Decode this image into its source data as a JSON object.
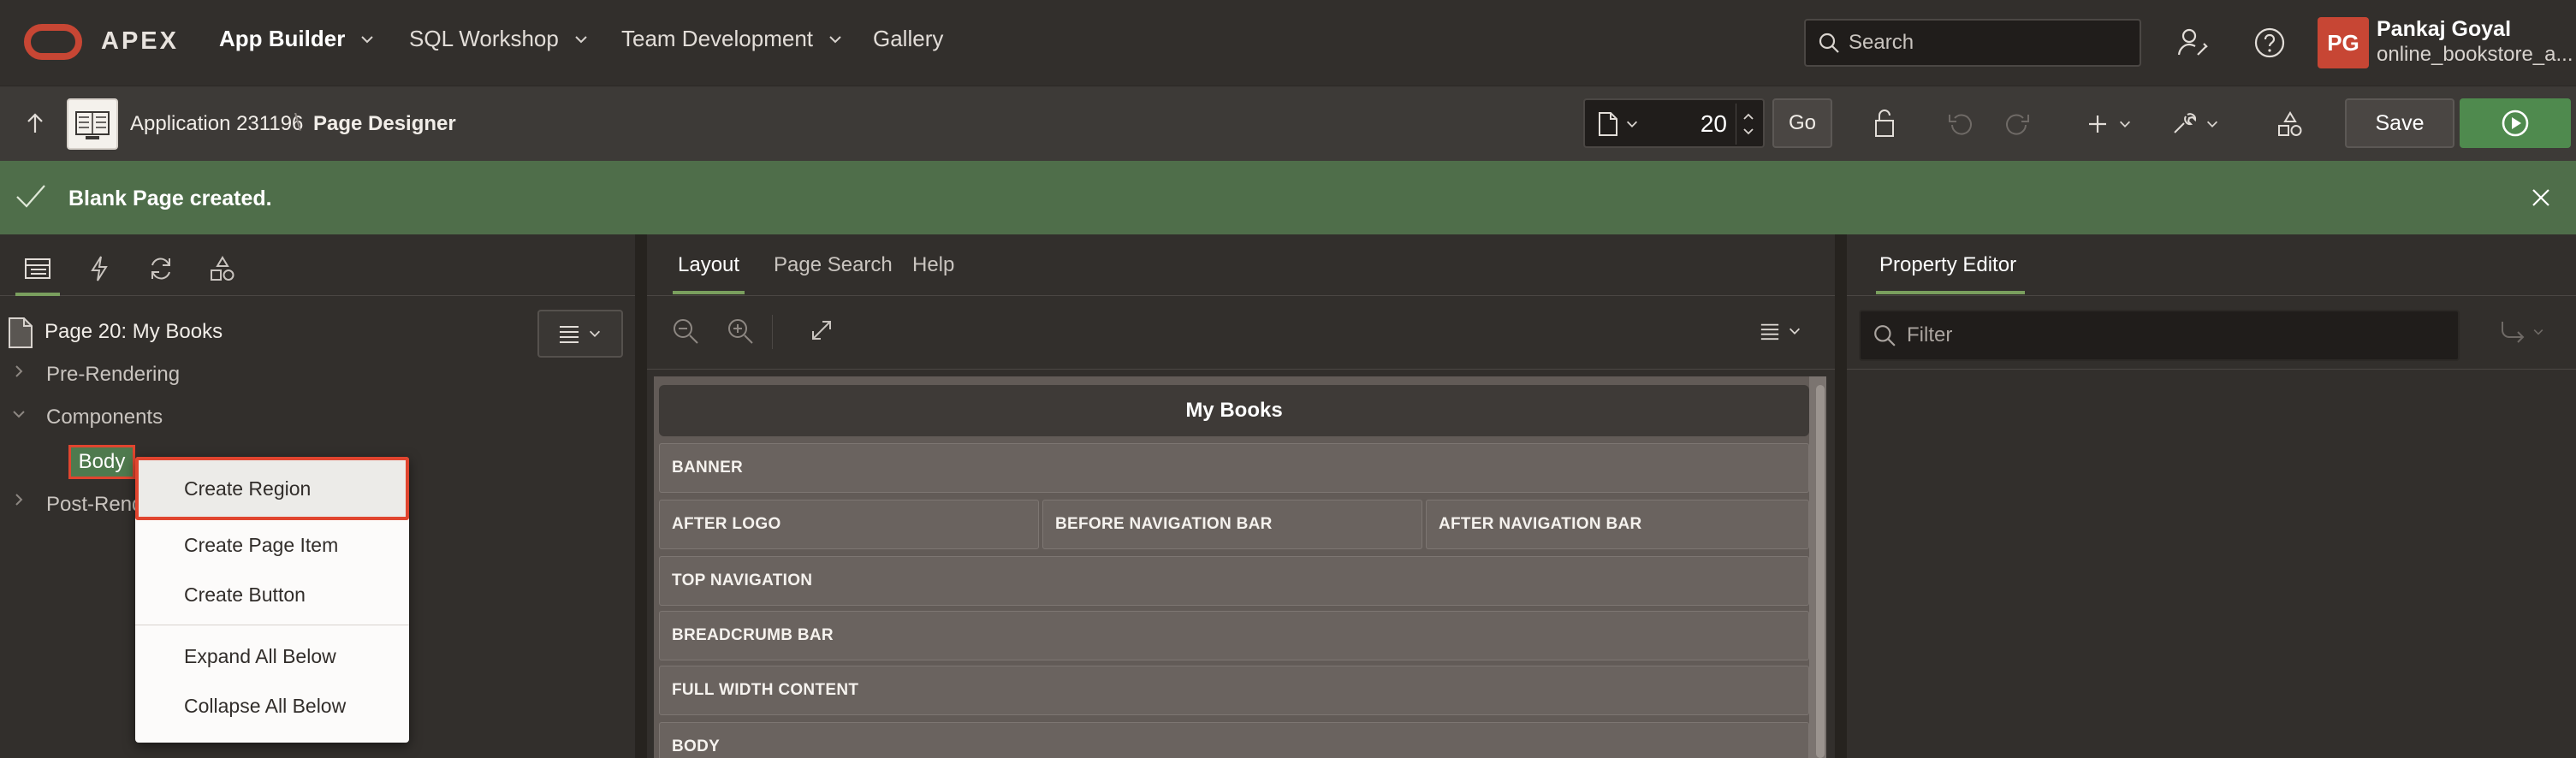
{
  "app": {
    "brand": "APEX",
    "nav": [
      "App Builder",
      "SQL Workshop",
      "Team Development",
      "Gallery"
    ],
    "search_placeholder": "Search",
    "user": {
      "initials": "PG",
      "name": "Pankaj Goyal",
      "workspace": "online_bookstore_a..."
    }
  },
  "toolbar": {
    "breadcrumb": [
      "Application 231196",
      "Page Designer"
    ],
    "breadcrumb_separator": "\\",
    "page_number": "20",
    "go_label": "Go",
    "save_label": "Save"
  },
  "banner": {
    "message": "Blank Page created."
  },
  "tree": {
    "root": "Page 20: My Books",
    "nodes": [
      "Pre-Rendering",
      "Components",
      "Post-Rend"
    ],
    "body": "Body"
  },
  "context_menu": {
    "items": [
      "Create Region",
      "Create Page Item",
      "Create Button",
      "Expand All Below",
      "Collapse All Below"
    ]
  },
  "center": {
    "tabs": [
      "Layout",
      "Page Search",
      "Help"
    ],
    "page_title": "My Books",
    "slots": [
      "BANNER",
      "AFTER LOGO",
      "BEFORE NAVIGATION BAR",
      "AFTER NAVIGATION BAR",
      "TOP NAVIGATION",
      "BREADCRUMB BAR",
      "FULL WIDTH CONTENT",
      "BODY"
    ]
  },
  "property_editor": {
    "tab": "Property Editor",
    "filter_placeholder": "Filter"
  },
  "colors": {
    "oracle_red": "#c74634",
    "success_banner": "#4f6e4a",
    "run_green": "#4f8a4e",
    "selection_red": "#e0452f",
    "active_tab_underline": "#7a9f5e"
  }
}
